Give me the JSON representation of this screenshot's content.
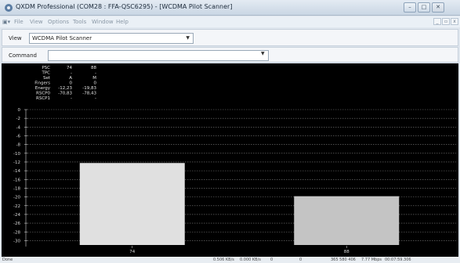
{
  "window": {
    "title": "QXDM Professional (COM28 : FFA-QSC6295) - [WCDMA Pilot Scanner]"
  },
  "menubar": {
    "items": [
      "File",
      "View",
      "Options",
      "Tools",
      "Window",
      "Help"
    ]
  },
  "view_row": {
    "label": "View",
    "selected": "WCDMA Pilot Scanner"
  },
  "command_row": {
    "label": "Command",
    "value": ""
  },
  "info_table": {
    "rows": [
      {
        "label": "PSC",
        "c1": "74",
        "c2": "88"
      },
      {
        "label": "TPC",
        "c1": "-",
        "c2": "-"
      },
      {
        "label": "Set",
        "c1": "A",
        "c2": "M"
      },
      {
        "label": "Fingers",
        "c1": "0",
        "c2": "0"
      },
      {
        "label": "Energy",
        "c1": "-12,23",
        "c2": "-19,83"
      },
      {
        "label": "RSCP0",
        "c1": "-70,83",
        "c2": "-78,43"
      },
      {
        "label": "RSCP1",
        "c1": "-",
        "c2": "-"
      }
    ]
  },
  "chart_data": {
    "type": "bar",
    "categories": [
      "74",
      "88"
    ],
    "values": [
      -12.23,
      -19.83
    ],
    "ylim": [
      -31,
      0
    ],
    "ytick_labels": [
      "0",
      "-2",
      "-4",
      "-6",
      "-8",
      "-10",
      "-12",
      "-14",
      "-16",
      "-18",
      "-20",
      "-22",
      "-24",
      "-26",
      "-28",
      "-30"
    ],
    "bar_colors": [
      "#e0e0e0",
      "#c4c4c4"
    ],
    "grid": true,
    "grid_color": "#7a7a7a",
    "background": "#000000"
  },
  "statusbar": {
    "status": "Done",
    "rx_rate": "0.506 KB/s",
    "tx_rate": "0.000 KB/s",
    "f1": "0",
    "f2": "0",
    "bytes": "365 580 406",
    "mbytes": "7.77 Mbps",
    "elapsed": "00:07:59.306"
  }
}
